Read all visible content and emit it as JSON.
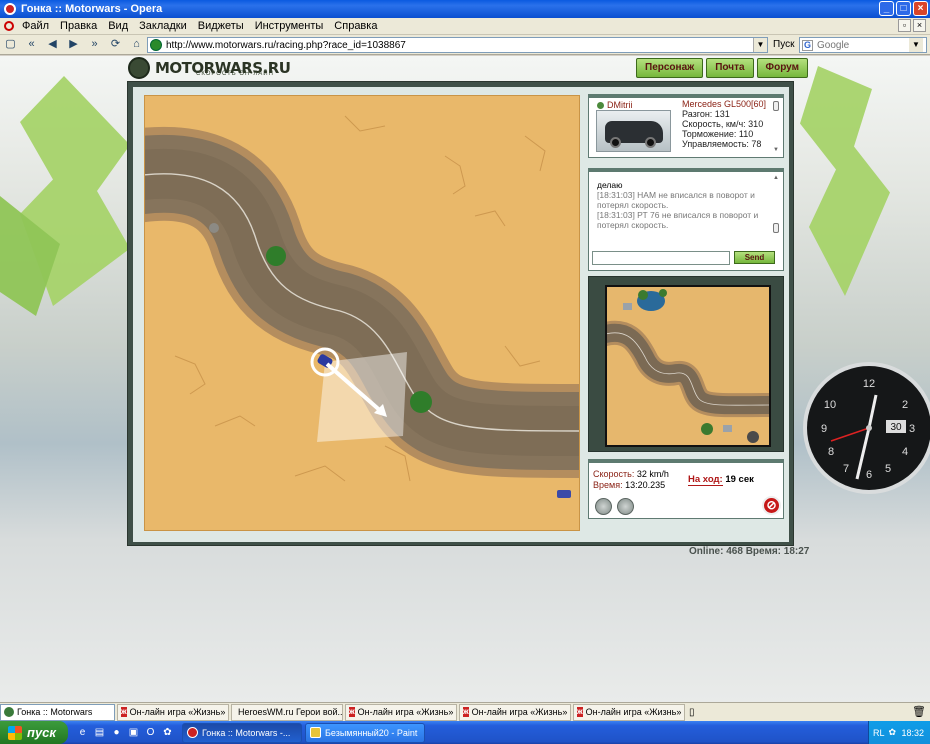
{
  "window": {
    "title": "Гонка :: Motorwars - Opera",
    "controls": [
      "_",
      "□",
      "×"
    ]
  },
  "menu": {
    "items": [
      "Файл",
      "Правка",
      "Вид",
      "Закладки",
      "Виджеты",
      "Инструменты",
      "Справка"
    ]
  },
  "address": {
    "url": "http://www.motorwars.ru/racing.php?race_id=1038867",
    "search_label": "Пуск",
    "search_placeholder": "Google",
    "search_engine_icon": "G"
  },
  "site": {
    "logo": "MOTORWARS.RU",
    "logo_sub": "СКОРОСТЬ ОН-ЛАЙН",
    "nav": [
      "Персонаж",
      "Почта",
      "Форум"
    ]
  },
  "car_info": {
    "player": "DMitrii",
    "car": "Mercedes GL500[60]",
    "stats": [
      "Разгон: 131",
      "Скорость, км/ч: 310",
      "Торможение: 110",
      "Управляемость: 78"
    ]
  },
  "chat": {
    "lines": [
      {
        "who": "делаю",
        "text": ""
      },
      {
        "who": "",
        "text": "[18:31:03] НАМ не вписался в поворот и потерял скорость."
      },
      {
        "who": "",
        "text": "[18:31:03] РТ 76 не вписался в поворот и потерял скорость."
      }
    ],
    "input_value": "",
    "send_label": "Send"
  },
  "race_status": {
    "speed_label": "Скорость:",
    "speed_value": "32 km/h",
    "time_label": "Время:",
    "time_value": "13:20.235",
    "turn_label": "На ход:",
    "turn_value": "19 сек"
  },
  "footer": {
    "online": "Online: 468",
    "time": "Время: 18:27"
  },
  "clock": {
    "numbers": [
      "12",
      "2",
      "3",
      "4",
      "5",
      "6",
      "7",
      "8",
      "9",
      "10"
    ],
    "date": "30"
  },
  "opera_tabs": [
    {
      "label": "Гонка :: Motorwars",
      "active": true,
      "icon": "opera"
    },
    {
      "label": "Он-лайн игра «Жизнь» ...",
      "active": false,
      "icon": "ж"
    },
    {
      "label": "HeroesWM.ru Герои вой...",
      "active": false,
      "icon": "heroes"
    },
    {
      "label": "Он-лайн игра «Жизнь» ...",
      "active": false,
      "icon": "ж"
    },
    {
      "label": "Он-лайн игра «Жизнь» ...",
      "active": false,
      "icon": "ж"
    },
    {
      "label": "Он-лайн игра «Жизнь» ...",
      "active": false,
      "icon": "ж"
    }
  ],
  "taskbar": {
    "start_label": "пуск",
    "buttons": [
      "Гонка :: Motorwars -...",
      "Безымянный20 - Paint"
    ],
    "tray_lang": "RL",
    "tray_time": "18:32"
  },
  "colors": {
    "titlebar": "#0a5ae0",
    "sand": "#e9b86a",
    "track": "#8a7a63",
    "accent_red": "#8b2316",
    "button_green": "#8cc84b",
    "taskbar": "#245edb"
  }
}
